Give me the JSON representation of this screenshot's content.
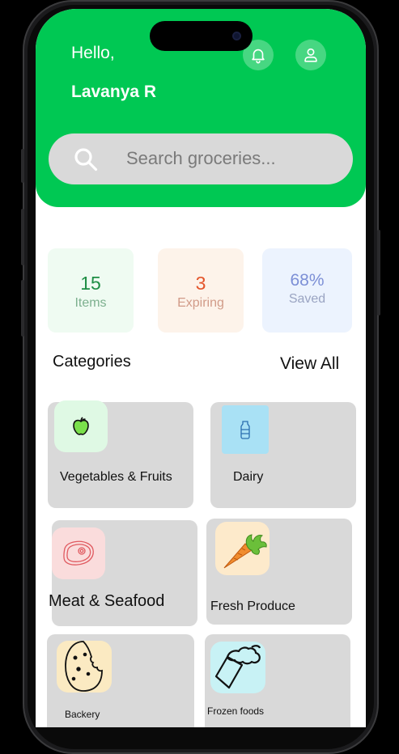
{
  "header": {
    "greeting": "Hello,",
    "user_name": "Lavanya R",
    "bell_icon": "bell-icon",
    "profile_icon": "user-icon"
  },
  "search": {
    "placeholder": "Search groceries...",
    "icon": "search-icon"
  },
  "stats": [
    {
      "value": "15",
      "label": "Items",
      "color": "#1e8e45"
    },
    {
      "value": "3",
      "label": "Expiring",
      "color": "#e4552b"
    },
    {
      "value": "68%",
      "label": "Saved",
      "color": "#7c8fd6"
    }
  ],
  "categories_section": {
    "title": "Categories",
    "view_all": "View All"
  },
  "categories": [
    {
      "label": "Vegetables & Fruits",
      "icon": "apple-icon",
      "icon_bg": "#dff9e4"
    },
    {
      "label": "Dairy",
      "icon": "milk-bottle-icon",
      "icon_bg": "#a9e1f5"
    },
    {
      "label": "Meat & Seafood",
      "icon": "steak-icon",
      "icon_bg": "#fadcdc"
    },
    {
      "label": "Fresh Produce",
      "icon": "carrot-icon",
      "icon_bg": "#fdeacb"
    },
    {
      "label": "Backery",
      "icon": "cookie-icon",
      "icon_bg": "#fbeac2"
    },
    {
      "label": "Frozen foods",
      "icon": "ice-cream-icon",
      "icon_bg": "#c8f2f5"
    }
  ],
  "colors": {
    "primary": "#00c853",
    "card": "#d9d9d9"
  }
}
